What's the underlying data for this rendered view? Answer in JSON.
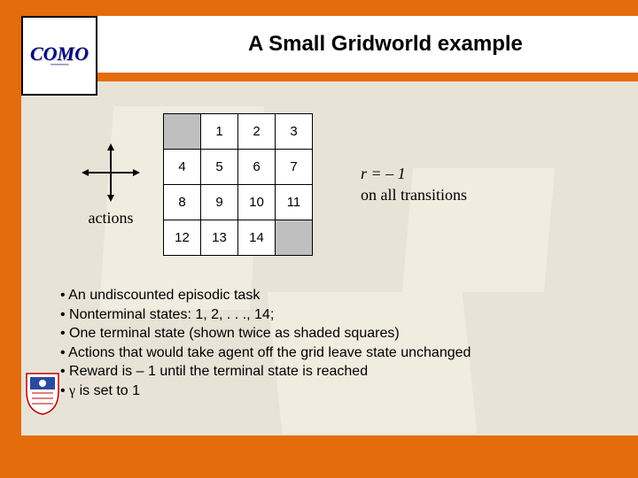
{
  "title": "A Small Gridworld example",
  "logo": {
    "main": "COMO",
    "sub": "———"
  },
  "figure": {
    "actions_label": "actions",
    "grid": {
      "cells": [
        [
          "",
          "1",
          "2",
          "3"
        ],
        [
          "4",
          "5",
          "6",
          "7"
        ],
        [
          "8",
          "9",
          "10",
          "11"
        ],
        [
          "12",
          "13",
          "14",
          ""
        ]
      ],
      "shaded": [
        [
          0,
          0
        ],
        [
          3,
          3
        ]
      ]
    },
    "reward_eq": "r  =  – 1",
    "reward_text": "on all transitions"
  },
  "bullets": [
    "An undiscounted episodic task",
    "Nonterminal states: 1, 2, . . ., 14;",
    "One terminal state (shown twice as shaded squares)",
    "Actions that would take agent off the grid leave state unchanged",
    "Reward is – 1 until the terminal state is reached",
    "γ is set to 1"
  ]
}
